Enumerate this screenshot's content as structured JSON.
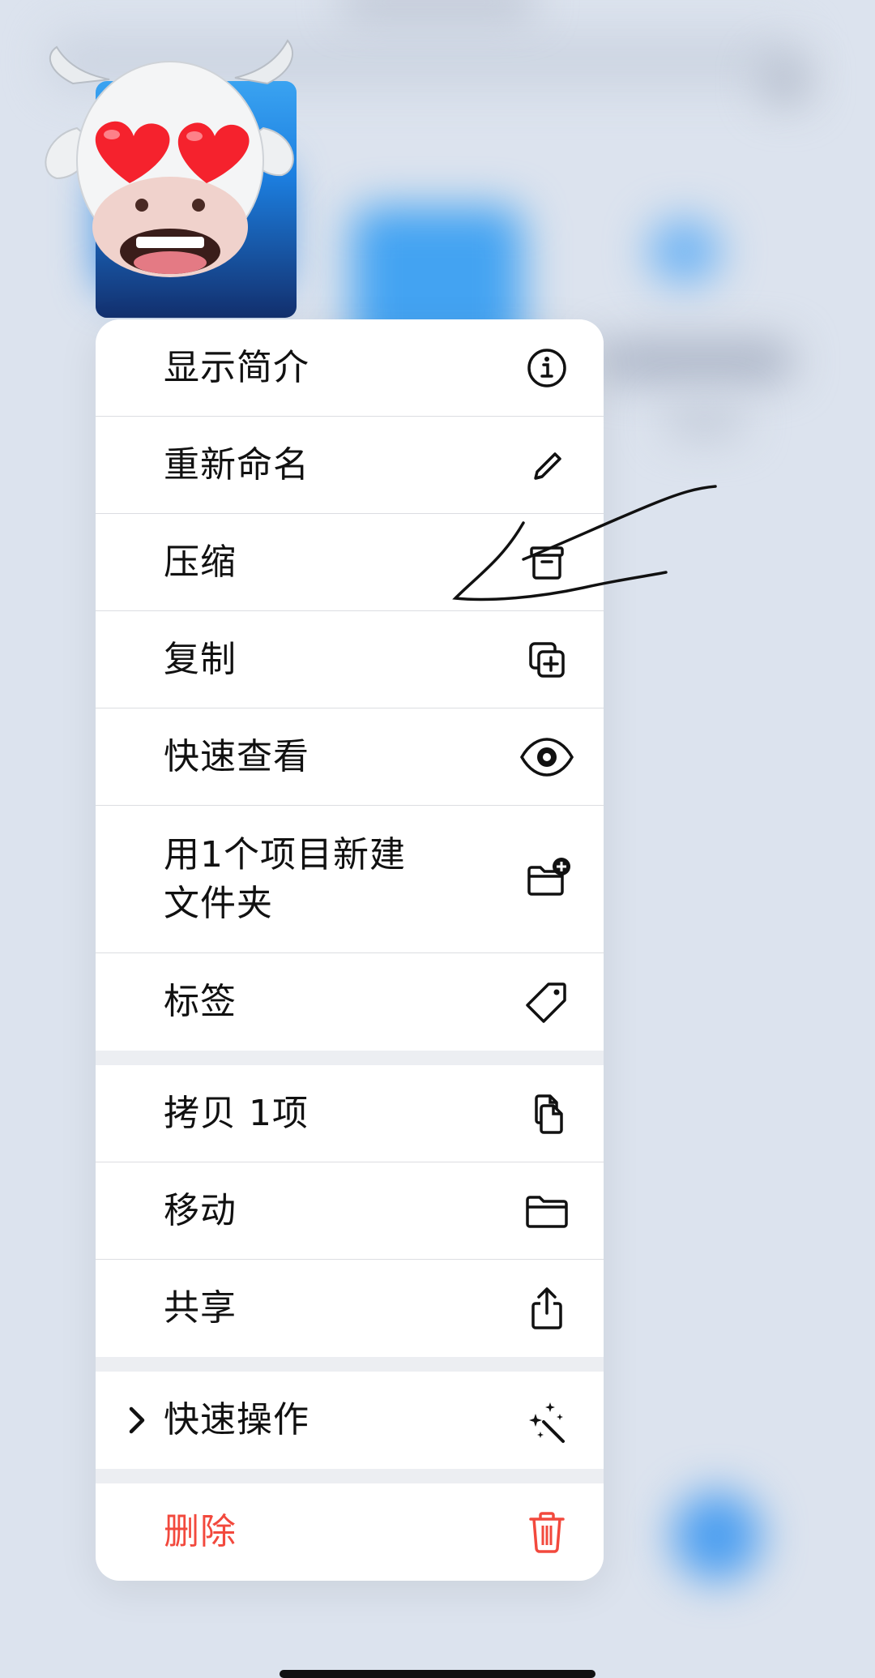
{
  "menu": {
    "groups": [
      {
        "items": [
          {
            "label": "显示简介",
            "icon": "info-icon"
          },
          {
            "label": "重新命名",
            "icon": "pencil-icon"
          },
          {
            "label": "压缩",
            "icon": "archive-icon"
          },
          {
            "label": "复制",
            "icon": "duplicate-icon"
          },
          {
            "label": "快速查看",
            "icon": "eye-icon"
          },
          {
            "label": "用1个项目新建\n文件夹",
            "icon": "folder-plus-icon"
          },
          {
            "label": "标签",
            "icon": "tag-icon"
          }
        ]
      },
      {
        "items": [
          {
            "label": "拷贝 1项",
            "icon": "copy-doc-icon"
          },
          {
            "label": "移动",
            "icon": "folder-icon"
          },
          {
            "label": "共享",
            "icon": "share-icon"
          }
        ]
      },
      {
        "items": [
          {
            "label": "快速操作",
            "icon": "sparkle-wand-icon",
            "submenu": true
          }
        ]
      },
      {
        "items": [
          {
            "label": "删除",
            "icon": "trash-icon",
            "destructive": true
          }
        ]
      }
    ]
  },
  "colors": {
    "destructive": "#f2493d",
    "menu_bg": "#ffffff",
    "separator": "#eceef2",
    "backdrop": "#dce3ee"
  }
}
